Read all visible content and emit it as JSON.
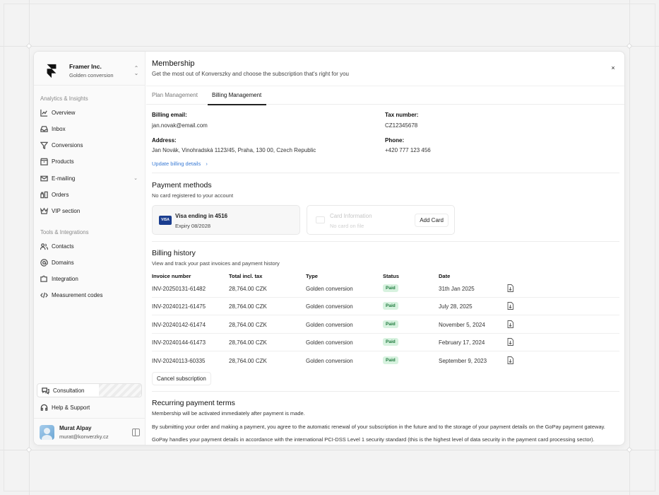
{
  "workspace": {
    "name": "Framer Inc.",
    "plan": "Golden conversion"
  },
  "sidebar": {
    "section1": "Analytics & Insights",
    "items1": [
      {
        "label": "Overview"
      },
      {
        "label": "Inbox"
      },
      {
        "label": "Conversions"
      },
      {
        "label": "Products"
      },
      {
        "label": "E-mailing"
      },
      {
        "label": "Orders"
      },
      {
        "label": "VIP section"
      }
    ],
    "section2": "Tools & Integrations",
    "items2": [
      {
        "label": "Contacts"
      },
      {
        "label": "Domains"
      },
      {
        "label": "Integration"
      },
      {
        "label": "Measurement codes"
      }
    ],
    "consultation": "Consultation",
    "help": "Help & Support"
  },
  "user": {
    "name": "Murat Alpay",
    "email": "murat@konverzky.cz"
  },
  "header": {
    "title": "Membership",
    "subtitle": "Get the most out of Konverszky and choose the subscription that's right for you",
    "close": "×"
  },
  "tabs": [
    {
      "label": "Plan Management"
    },
    {
      "label": "Billing Management"
    }
  ],
  "billing": {
    "email_label": "Billing email:",
    "email": "jan.novak@email.com",
    "tax_label": "Tax number:",
    "tax": "CZ12345678",
    "address_label": "Address:",
    "address": "Jan Novák, Vinohradská 1123/45, Praha, 130 00, Czech Republic",
    "phone_label": "Phone:",
    "phone": "+420 777 123 456",
    "update_link": "Update billing details",
    "update_chevron": "›"
  },
  "payment": {
    "title": "Payment methods",
    "desc": "No card registered to your account",
    "card_brand": "VISA",
    "card_title": "Visa ending in 4516",
    "card_expiry": "Expiry 08/2028",
    "new_title": "Card Information",
    "new_sub": "No card on file",
    "add_label": "Add Card"
  },
  "history": {
    "title": "Billing history",
    "desc": "View and track your past invoices and payment history",
    "columns": [
      "Invoice number",
      "Total incl. tax",
      "Type",
      "Status",
      "Date"
    ],
    "rows": [
      {
        "invoice": "INV-20250131-61482",
        "total": "28,764.00 CZK",
        "type": "Golden conversion",
        "status": "Paid",
        "date": "31th Jan 2025"
      },
      {
        "invoice": "INV-20240121-61475",
        "total": "28,764.00 CZK",
        "type": "Golden conversion",
        "status": "Paid",
        "date": "July 28, 2025"
      },
      {
        "invoice": "INV-20240142-61474",
        "total": "28,764.00 CZK",
        "type": "Golden conversion",
        "status": "Paid",
        "date": "November 5, 2024"
      },
      {
        "invoice": "INV-20240144-61473",
        "total": "28,764.00 CZK",
        "type": "Golden conversion",
        "status": "Paid",
        "date": "February 17, 2024"
      },
      {
        "invoice": "INV-20240113-60335",
        "total": "28,764.00 CZK",
        "type": "Golden conversion",
        "status": "Paid",
        "date": "September 9, 2023"
      }
    ],
    "cancel_label": "Cancel subscription"
  },
  "terms": {
    "title": "Recurring payment terms",
    "line1": "Membership will be activated immediately after payment is made.",
    "line2": "By submitting your order and making a payment, you agree to the automatic renewal of your subscription in the future and to the storage of your payment details on the GoPay payment gateway.",
    "line3": "GoPay handles your payment details in accordance with the international PCI-DSS Level 1 security standard (this is the highest level of data security in the payment card processing sector)."
  },
  "colors": {
    "accent_link": "#3a7bd5",
    "paid_bg": "#d7f2df",
    "paid_text": "#1f7a3e",
    "visa": "#1a3d8f"
  }
}
